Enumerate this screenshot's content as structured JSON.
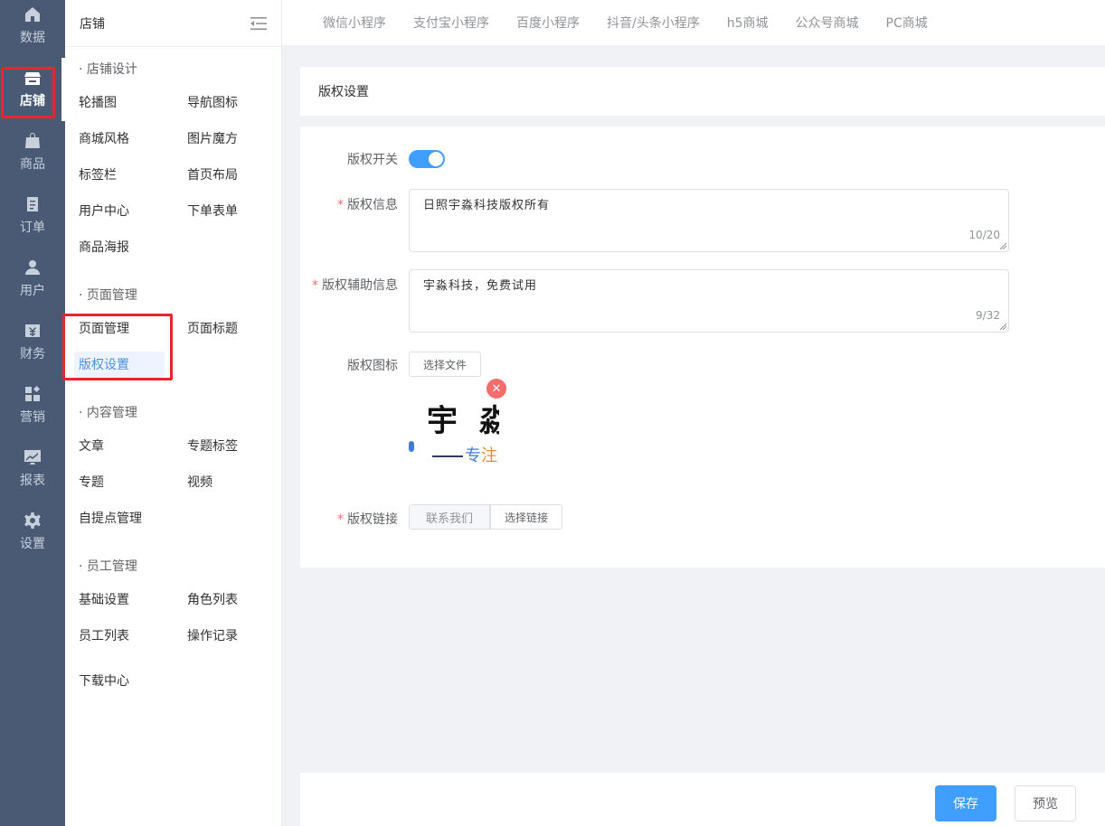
{
  "rail": {
    "items": [
      {
        "label": "数据",
        "icon": "home-icon"
      },
      {
        "label": "店铺",
        "icon": "store-icon"
      },
      {
        "label": "商品",
        "icon": "bag-icon"
      },
      {
        "label": "订单",
        "icon": "order-icon"
      },
      {
        "label": "用户",
        "icon": "user-icon"
      },
      {
        "label": "财务",
        "icon": "finance-icon"
      },
      {
        "label": "营销",
        "icon": "marketing-icon"
      },
      {
        "label": "报表",
        "icon": "report-icon"
      },
      {
        "label": "设置",
        "icon": "settings-icon"
      }
    ],
    "active": "店铺",
    "highlight_color": "#e8262b"
  },
  "subpanel": {
    "title": "店铺",
    "groups": [
      {
        "title": "· 店铺设计",
        "items": [
          "轮播图",
          "导航图标",
          "商城风格",
          "图片魔方",
          "标签栏",
          "首页布局",
          "用户中心",
          "下单表单",
          "商品海报"
        ]
      },
      {
        "title": "· 页面管理",
        "items": [
          "页面管理",
          "页面标题",
          "版权设置"
        ]
      },
      {
        "title": "· 内容管理",
        "items": [
          "文章",
          "专题标签",
          "专题",
          "视频",
          "自提点管理"
        ]
      },
      {
        "title": "· 员工管理",
        "items": [
          "基础设置",
          "角色列表",
          "员工列表",
          "操作记录"
        ]
      }
    ],
    "extra": "下载中心",
    "active_item": "版权设置"
  },
  "tabs": [
    "微信小程序",
    "支付宝小程序",
    "百度小程序",
    "抖音/头条小程序",
    "h5商城",
    "公众号商城",
    "PC商城"
  ],
  "page": {
    "title": "版权设置"
  },
  "form": {
    "switch_label": "版权开关",
    "switch_on": true,
    "info_label": "版权信息",
    "info_value": "日照宇淼科技版权所有",
    "info_count": "10/20",
    "aux_label": "版权辅助信息",
    "aux_value": "宇淼科技，免费试用",
    "aux_count": "9/32",
    "icon_label": "版权图标",
    "choose_file": "选择文件",
    "logo_text": "宇 淼",
    "logo_sub_blue": "专",
    "logo_sub_orange": "注",
    "link_label": "版权链接",
    "link_value": "联系我们",
    "choose_link": "选择链接",
    "accent_color": "#409eff"
  },
  "footer": {
    "save": "保存",
    "preview": "预览"
  }
}
